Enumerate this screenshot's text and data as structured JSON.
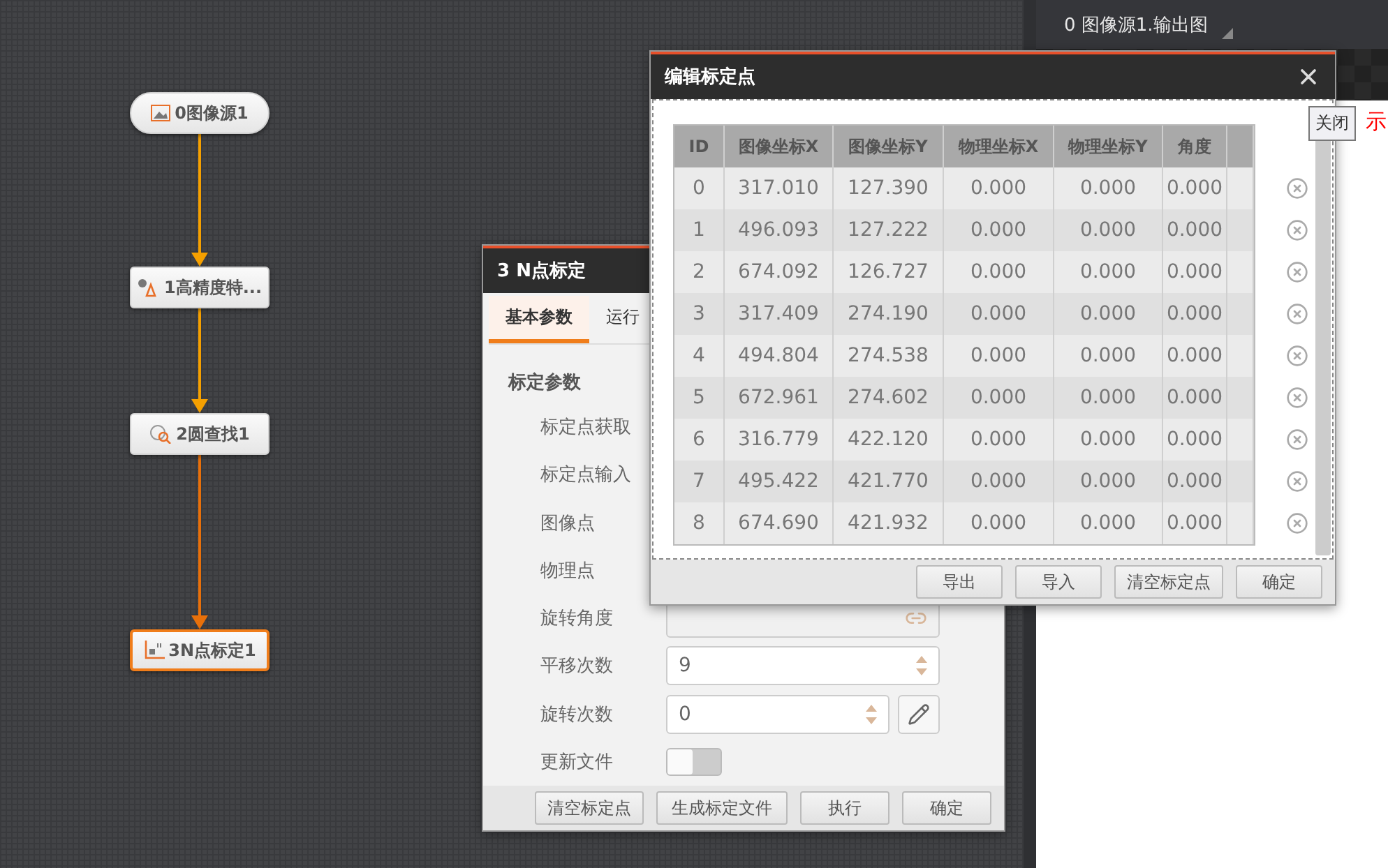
{
  "canvas": {
    "nodes": [
      {
        "label": "0图像源1",
        "kind": "source",
        "selected": false
      },
      {
        "label": "1高精度特...",
        "kind": "feature",
        "selected": false
      },
      {
        "label": "2圆查找1",
        "kind": "circle",
        "selected": false
      },
      {
        "label": "3N点标定1",
        "kind": "calib",
        "selected": true
      }
    ]
  },
  "output_panel": {
    "title": "0 图像源1.输出图",
    "note": "示"
  },
  "param_panel": {
    "title": "3 N点标定",
    "tabs": [
      {
        "label": "基本参数",
        "selected": true
      },
      {
        "label": "运行",
        "selected": false
      }
    ],
    "section": "标定参数",
    "fields": [
      {
        "label": "标定点获取",
        "kind": "plain"
      },
      {
        "label": "标定点输入",
        "kind": "plain"
      },
      {
        "label": "图像点",
        "kind": "plain"
      },
      {
        "label": "物理点",
        "kind": "plain"
      },
      {
        "label": "旋转角度",
        "kind": "link"
      },
      {
        "label": "平移次数",
        "kind": "spin",
        "value": "9"
      },
      {
        "label": "旋转次数",
        "kind": "spin_edit",
        "value": "0"
      },
      {
        "label": "更新文件",
        "kind": "toggle",
        "on": false
      }
    ],
    "buttons": [
      "清空标定点",
      "生成标定文件",
      "执行",
      "确定"
    ]
  },
  "dialog": {
    "title": "编辑标定点",
    "tooltip": "关闭",
    "columns": [
      "ID",
      "图像坐标X",
      "图像坐标Y",
      "物理坐标X",
      "物理坐标Y",
      "角度"
    ],
    "rows": [
      [
        "0",
        "317.010",
        "127.390",
        "0.000",
        "0.000",
        "0.000"
      ],
      [
        "1",
        "496.093",
        "127.222",
        "0.000",
        "0.000",
        "0.000"
      ],
      [
        "2",
        "674.092",
        "126.727",
        "0.000",
        "0.000",
        "0.000"
      ],
      [
        "3",
        "317.409",
        "274.190",
        "0.000",
        "0.000",
        "0.000"
      ],
      [
        "4",
        "494.804",
        "274.538",
        "0.000",
        "0.000",
        "0.000"
      ],
      [
        "5",
        "672.961",
        "274.602",
        "0.000",
        "0.000",
        "0.000"
      ],
      [
        "6",
        "316.779",
        "422.120",
        "0.000",
        "0.000",
        "0.000"
      ],
      [
        "7",
        "495.422",
        "421.770",
        "0.000",
        "0.000",
        "0.000"
      ],
      [
        "8",
        "674.690",
        "421.932",
        "0.000",
        "0.000",
        "0.000"
      ]
    ],
    "buttons": [
      "导出",
      "导入",
      "清空标定点",
      "确定"
    ]
  }
}
